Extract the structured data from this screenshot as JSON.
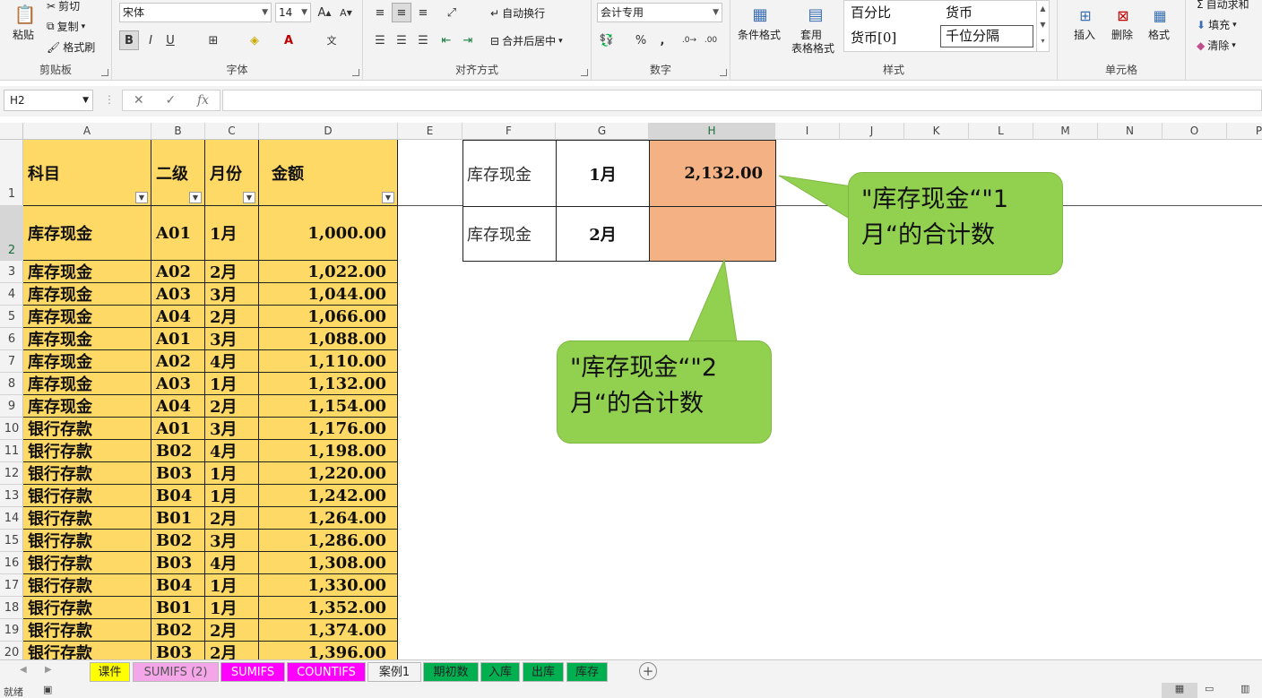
{
  "ribbon": {
    "clipboard": {
      "paste": "粘贴",
      "cut": "剪切",
      "copy": "复制",
      "format_painter": "格式刷",
      "label": "剪贴板"
    },
    "font": {
      "name": "宋体",
      "size": "14",
      "bold": "B",
      "italic": "I",
      "underline": "U",
      "label": "字体"
    },
    "alignment": {
      "wrap": "自动换行",
      "merge": "合并后居中",
      "label": "对齐方式"
    },
    "number": {
      "format": "会计专用",
      "percent": "%",
      "comma": ",",
      "label": "数字"
    },
    "styles": {
      "conditional": "条件格式",
      "table_format_1": "套用",
      "table_format_2": "表格格式",
      "items": [
        "百分比",
        "货币",
        "货币[0]",
        "千位分隔"
      ],
      "label": "样式"
    },
    "cells": {
      "insert": "插入",
      "delete": "删除",
      "format": "格式",
      "label": "单元格"
    },
    "editing": {
      "autosum": "自动求和",
      "fill": "填充",
      "clear": "清除"
    }
  },
  "formula_bar": {
    "name_box": "H2",
    "cancel": "✕",
    "enter": "✓",
    "fx": "fx",
    "value": ""
  },
  "columns": [
    "A",
    "B",
    "C",
    "D",
    "E",
    "F",
    "G",
    "H",
    "I",
    "J",
    "K",
    "L",
    "M",
    "N",
    "O",
    "P"
  ],
  "rows": [
    "1",
    "2",
    "3",
    "4",
    "5",
    "6",
    "7",
    "8",
    "9",
    "10",
    "11",
    "12",
    "13",
    "14",
    "15",
    "16",
    "17",
    "18",
    "19",
    "20"
  ],
  "table": {
    "headers": [
      "科目",
      "二级",
      "月份",
      "金额"
    ],
    "rows": [
      [
        "库存现金",
        "A01",
        "1月",
        "1,000.00"
      ],
      [
        "库存现金",
        "A02",
        "2月",
        "1,022.00"
      ],
      [
        "库存现金",
        "A03",
        "3月",
        "1,044.00"
      ],
      [
        "库存现金",
        "A04",
        "2月",
        "1,066.00"
      ],
      [
        "库存现金",
        "A01",
        "3月",
        "1,088.00"
      ],
      [
        "库存现金",
        "A02",
        "4月",
        "1,110.00"
      ],
      [
        "库存现金",
        "A03",
        "1月",
        "1,132.00"
      ],
      [
        "库存现金",
        "A04",
        "2月",
        "1,154.00"
      ],
      [
        "银行存款",
        "A01",
        "3月",
        "1,176.00"
      ],
      [
        "银行存款",
        "B02",
        "4月",
        "1,198.00"
      ],
      [
        "银行存款",
        "B03",
        "1月",
        "1,220.00"
      ],
      [
        "银行存款",
        "B04",
        "1月",
        "1,242.00"
      ],
      [
        "银行存款",
        "B01",
        "2月",
        "1,264.00"
      ],
      [
        "银行存款",
        "B02",
        "3月",
        "1,286.00"
      ],
      [
        "银行存款",
        "B03",
        "4月",
        "1,308.00"
      ],
      [
        "银行存款",
        "B04",
        "1月",
        "1,330.00"
      ],
      [
        "银行存款",
        "B01",
        "1月",
        "1,352.00"
      ],
      [
        "银行存款",
        "B02",
        "2月",
        "1,374.00"
      ],
      [
        "银行存款",
        "B03",
        "2月",
        "1,396.00"
      ]
    ]
  },
  "summary": [
    {
      "account": "库存现金",
      "month": "1月",
      "total": "2,132.00"
    },
    {
      "account": "库存现金",
      "month": "2月",
      "total": ""
    }
  ],
  "callouts": [
    "\"库存现金“\"1月“的合计数",
    "\"库存现金“\"2月“的合计数"
  ],
  "sheet_tabs": [
    "课件",
    "SUMIFS (2)",
    "SUMIFS",
    "COUNTIFS",
    "案例1",
    "期初数",
    "入库",
    "出库",
    "库存"
  ],
  "status": "就绪",
  "colors": {
    "table_fill": "#ffd966",
    "result_fill": "#f4b183",
    "callout_fill": "#92d050"
  }
}
